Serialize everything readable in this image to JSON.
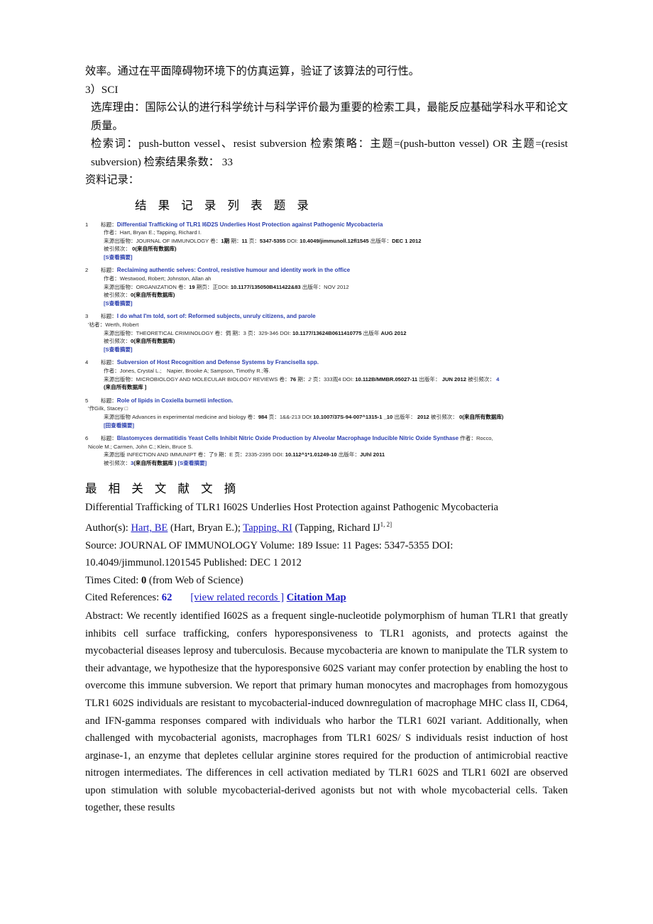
{
  "top_text": {
    "line_efficiency": "效率。通过在平面障碍物环境下的仿真运算，验证了该算法的可行性。",
    "item_label": "3）SCI",
    "reason": "选库理由：国际公认的进行科学统计与科学评价最为重要的检索工具，最能反应基础学科水平和论文质量。",
    "keywords": "检索词：push-button vessel、resist subversion 检索策略：主题=(push-button vessel) OR 主题=(resist subversion) 检索结果条数：   33",
    "records_label": "资料记录："
  },
  "results_heading": "结 果 记 录 列 表 题 录",
  "records": [
    {
      "num": "1",
      "title_label": "标题：",
      "title": "Differential Trafficking of TLR1 I6D2S Underlies Host Protection against Pathogenic Mycobacteria",
      "author_label": "作者：",
      "authors": "Hart, Bryan E.; Tapping, Richard I.",
      "source_label": "来源出版物：",
      "source": "JOURNAL OF IMMUNOLOGY",
      "volume_label": "卷：",
      "volume": "1期",
      "issue_label": "期：",
      "issue": "11",
      "pages_label": "页：",
      "pages": "5347-5355",
      "doi_label": "DOI:",
      "doi": "10.4049/jimmunoll.12fl1545",
      "pubyear_label": "出版年：",
      "pubyear": "DEC 1 2012",
      "cited_label": "被引频次：",
      "cited": "0",
      "cited_suffix": "(来自所有数据库)",
      "abstract_link": "[S查看摘要]"
    },
    {
      "num": "2",
      "title_label": "标题：",
      "title": "Reclaiming authentic selves: Control, resistive humour and identity work in the office",
      "author_label": "作者：",
      "authors": "Westwood, Robert; Johnston, Allan ah",
      "source_label": "来源出版物：",
      "source": "ORGANIZATION",
      "volume_label": "卷：",
      "volume": "19",
      "issue_label": "期页：",
      "issue": "正",
      "doi_label": "DOI:",
      "doi": "10.1177/135050B411422&83",
      "pubyear_label": "出版年：",
      "pubyear": "NOV 2012",
      "cited_label": "被引频次：",
      "cited": "0",
      "cited_suffix": "(来自所有数据库)",
      "abstract_link": "[S查看摘要]"
    },
    {
      "num": "3",
      "title_label": "标题：",
      "title": "I do what I'm told, sort of: Reformed subjects, unruly citizens, and parole",
      "author_label": "'祜者：",
      "authors": "Werth, Robert",
      "source_label": "来源出版物：",
      "source": "THEORETICAL CRIMINOLOGY",
      "volume_label": "卷：",
      "volume": "倜",
      "issue_label": "期：",
      "issue": "3",
      "pages_label": "页：",
      "pages": "329-346",
      "doi_label": "DOI:",
      "doi": "10.1177/13624B0611410775",
      "pubyear_label": "出版年",
      "pubyear": "AUG 2012",
      "cited_label": "被引频次：",
      "cited": "0",
      "cited_suffix": "(来自所有数据库)",
      "abstract_link": "[S查看摘要]"
    },
    {
      "num": "4",
      "title_label": "标题：",
      "title": "Subversion of Host Recognition and Defense Systems by Francisella spp.",
      "author_label": "作者：",
      "authors": "Jones, Crystal L.;　Napier, Brooke A; Sampson, Timothy R.;等.",
      "source_label": "来源出版物：",
      "source": "MICROBIOLOGY AND MOLECULAR BIOLOGY REVIEWS",
      "volume_label": "卷：",
      "volume": "76",
      "issue_label": "期：",
      "issue": "2",
      "pages_label": "页：",
      "pages": "333观4",
      "doi_label": "DOI:",
      "doi": "10.112B/MMBR.05027-11",
      "pubyear_label": "出版年：",
      "pubyear": "JUN 2012",
      "cited_label": "被引频次：",
      "cited": "4",
      "cited_suffix": "(来自所有数据库 ]"
    },
    {
      "num": "5",
      "title_label": "标题：",
      "title": "Role of lipids in Coxiella burnetii infection.",
      "author_label": "'作",
      "authors": "Gilk, Stacey □",
      "source_label": "来源出版物",
      "source": "Advances in experimental medicine and biology",
      "volume_label": "卷：",
      "volume": "984",
      "pages_label": "页：",
      "pages": "1&&-213",
      "doi_label": "DOt",
      "doi": "10.1007/37S-94-007^1315-1 _10",
      "pubyear_label": "出版年：",
      "pubyear": "2012",
      "cited_label": "被引频次：",
      "cited": "0",
      "cited_suffix": "(来自所有数据库)",
      "abstract_link": "[田查看摘要]"
    },
    {
      "num": "6",
      "title_label": "标题：",
      "title": "Blastomyces dermatitidis Yeast Cells Inhibit Nitric Oxide Production by Alveolar Macrophage Inducible Nitric Oxide Synthase",
      "author_label": "作者：",
      "authors_inline": "Rocco,",
      "authors": "Nicole M.; Carmen, John C.; Klein, Bruce S.",
      "source_label": "来源出版",
      "source": "INFECTION AND IMMUNIPT",
      "volume_label": "卷：",
      "volume": "了9",
      "issue_label": "期：",
      "issue": "E",
      "pages_label": "页：",
      "pages": "2335-2395",
      "doi_label": "DOI:",
      "doi": "10.112^1*1.01249-10",
      "pubyear_label": "出版年：",
      "pubyear": "JUhl 2011",
      "cited_label": "被引频次：",
      "cited": "3",
      "cited_suffix": "(来自所有数据库 )",
      "abstract_link": "[S查看摘要]"
    }
  ],
  "abstract_section": {
    "heading": "最 相 关 文 献 文 摘",
    "title": "Differential Trafficking of TLR1 I602S Underlies Host Protection against Pathogenic Mycobacteria",
    "authors_label": "Author(s):",
    "author1_link": "Hart, BE",
    "author1_full": "(Hart, Bryan E.);",
    "author2_link": "Tapping, RI",
    "author2_full": "(Tapping, Richard IJ",
    "author_sup": "1, 2]",
    "source_line1": "Source: JOURNAL OF IMMUNOLOGY Volume: 189 Issue: 11 Pages: 5347-5355 DOI:",
    "source_line2_doi": "10.4049/jimmunol.1201545 Published: DEC 1 2012",
    "times_cited_label": "Times Cited:",
    "times_cited": "0",
    "times_cited_suffix": "(from Web of Science)",
    "cited_refs_label": "Cited References:",
    "cited_refs": "62",
    "view_related": "[view related records ]",
    "citation_map": "Citation Map",
    "abstract_text": "Abstract: We recently identified I602S as a frequent single-nucleotide polymorphism of human TLR1 that greatly inhibits cell surface trafficking, confers hyporesponsiveness to TLR1 agonists, and protects against the mycobacterial diseases leprosy and tuberculosis. Because mycobacteria are known to manipulate the TLR system to their advantage, we hypothesize that the hyporesponsive 602S variant may confer protection by enabling the host to overcome this immune subversion. We report that primary human monocytes and macrophages from homozygous TLR1 602S individuals are resistant to mycobacterial-induced downregulation of macrophage MHC class II, CD64, and IFN-gamma responses compared with individuals who harbor the TLR1 602I variant. Additionally, when challenged with mycobacterial agonists, macrophages from TLR1 602S/ S individuals resist induction of host arginase-1, an enzyme that depletes cellular arginine stores required for the production of antimicrobial reactive nitrogen intermediates. The differences in cell activation mediated by TLR1 602S and TLR1 602I are observed upon stimulation with soluble mycobacterial-derived agonists but not with whole mycobacterial cells. Taken together, these results"
  },
  "colors": {
    "link_blue": "#1b1bc4",
    "record_blue": "#2b3fae",
    "text": "#0d0d0d"
  }
}
